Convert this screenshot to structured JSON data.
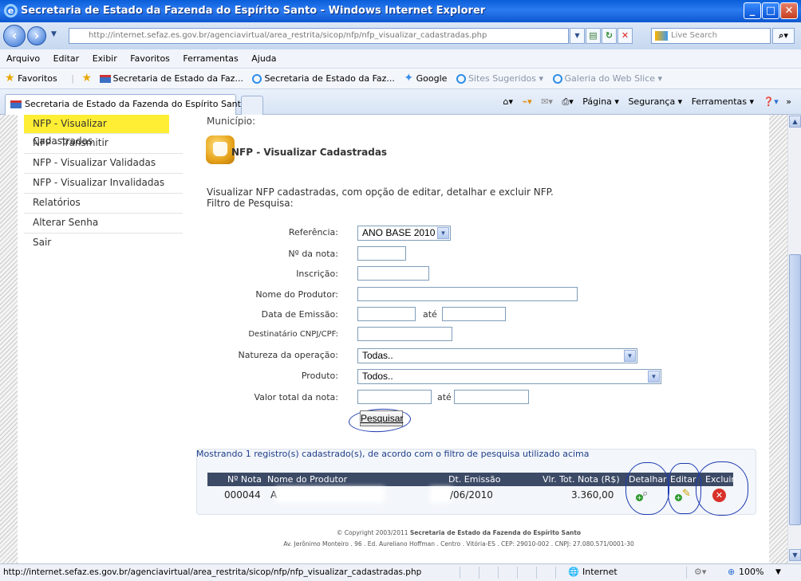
{
  "window": {
    "title": "Secretaria de Estado da Fazenda do Espírito Santo - Windows Internet Explorer",
    "buttons": {
      "minimize": "_",
      "maximize": "□",
      "close": "✕"
    }
  },
  "address_bar": {
    "url": "http://internet.sefaz.es.gov.br/agenciavirtual/area_restrita/sicop/nfp/nfp_visualizar_cadastradas.php",
    "search_placeholder": "Live Search"
  },
  "menu": [
    "Arquivo",
    "Editar",
    "Exibir",
    "Favoritos",
    "Ferramentas",
    "Ajuda"
  ],
  "favorites_bar": {
    "favorites_label": "Favoritos",
    "links": [
      "Secretaria de Estado da Faz...",
      "Secretaria de Estado da Faz...",
      "Google",
      "Sites Sugeridos ▾",
      "Galeria do Web Slice ▾"
    ]
  },
  "tab": {
    "title": "Secretaria de Estado da Fazenda do Espírito Santo"
  },
  "command_bar": [
    "Página ▾",
    "Segurança ▾",
    "Ferramentas ▾"
  ],
  "sidebar": {
    "items": [
      {
        "label": "NFP - Visualizar Cadastradas",
        "active": true
      },
      {
        "label": "NFP - Transmitir"
      },
      {
        "label": "NFP - Visualizar Validadas"
      },
      {
        "label": "NFP - Visualizar Invalidadas"
      },
      {
        "label": "Relatórios"
      },
      {
        "label": "Alterar Senha"
      },
      {
        "label": "Sair"
      }
    ]
  },
  "main": {
    "municipio_label": "Município:",
    "section_title": "NFP - Visualizar Cadastradas",
    "description": "Visualizar NFP cadastradas, com opção de editar, detalhar e excluir NFP.",
    "filter_title": "Filtro de Pesquisa:",
    "fields": {
      "referencia": {
        "label": "Referência:",
        "value": "ANO BASE 2010"
      },
      "numero_nota": {
        "label": "Nº da nota:"
      },
      "inscricao": {
        "label": "Inscrição:"
      },
      "nome_produtor": {
        "label": "Nome do Produtor:"
      },
      "data_emissao": {
        "label": "Data de Emissão:",
        "sep": "até"
      },
      "destinatario": {
        "label": "Destinatário CNPJ/CPF:"
      },
      "natureza": {
        "label": "Natureza da operação:",
        "value": "Todas.."
      },
      "produto": {
        "label": "Produto:",
        "value": "Todos.."
      },
      "valor_total": {
        "label": "Valor total da nota:",
        "sep": "até"
      }
    },
    "search_button": "Pesquisar",
    "results_summary": "Mostrando 1 registro(s) cadastrado(s), de acordo com o filtro de pesquisa utilizado acima",
    "table": {
      "headers": [
        "Nº Nota",
        "Nome do Produtor",
        "Dt. Emissão",
        "Vlr. Tot. Nota (R$)",
        "Detalhar",
        "Editar",
        "Excluir"
      ],
      "rows": [
        {
          "numero": "000044",
          "produtor": "A",
          "data": "/06/2010",
          "valor": "3.360,00"
        }
      ]
    }
  },
  "footer": {
    "copyright_prefix": "© Copyright 2003/2011",
    "org": "Secretaria de Estado da Fazenda do Espírito Santo",
    "address": "Av. Jerônimo Monteiro . 96 . Ed. Aureliano Hoffman . Centro . Vitória-ES . CEP: 29010-002 . CNPJ: 27.080.571/0001-30"
  },
  "status_bar": {
    "url": "http://internet.sefaz.es.gov.br/agenciavirtual/area_restrita/sicop/nfp/nfp_visualizar_cadastradas.php",
    "zone": "Internet",
    "zoom": "100%"
  }
}
